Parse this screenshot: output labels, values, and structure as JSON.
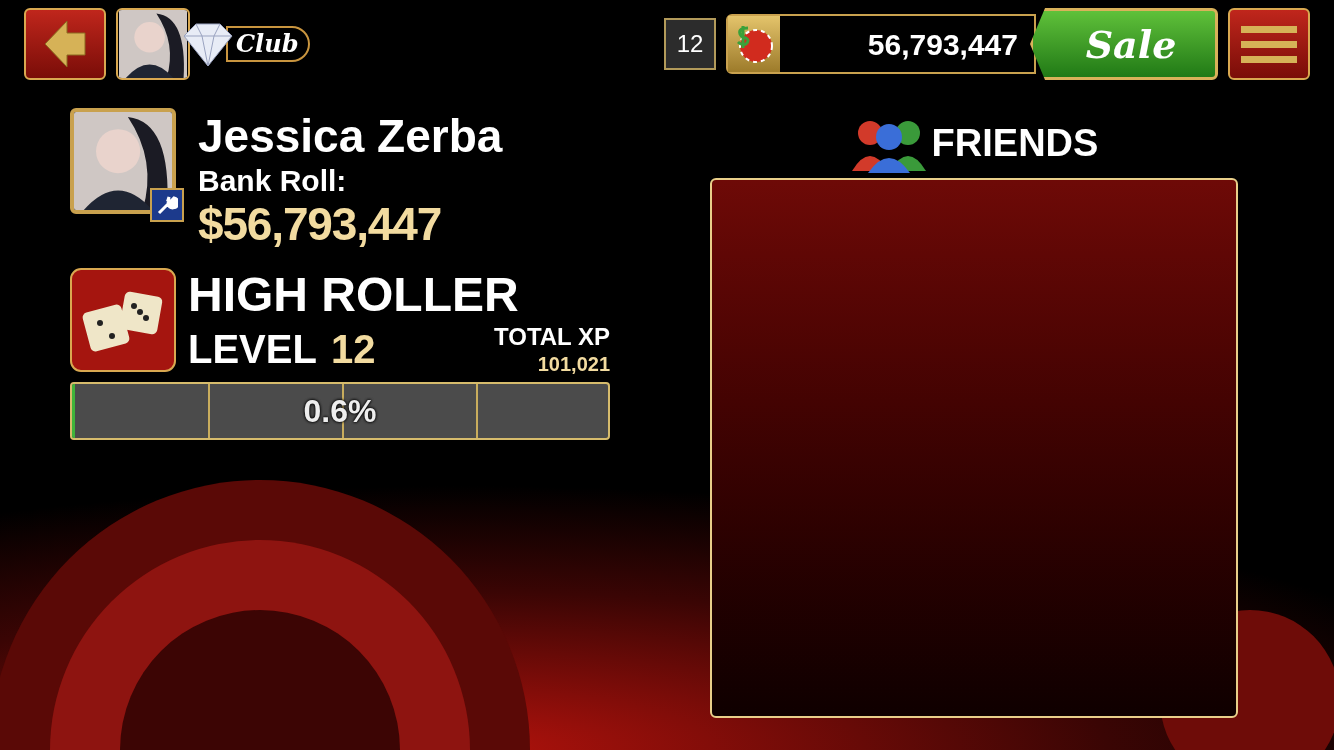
{
  "top_bar": {
    "club_badge": "Club",
    "level_badge": "12",
    "chips": "56,793,447",
    "sale_button": "Sale"
  },
  "profile": {
    "name": "Jessica Zerba",
    "bank_roll_label": "Bank Roll:",
    "bank_roll": "$56,793,447"
  },
  "rank": {
    "title": "HIGH ROLLER",
    "level_label": "LEVEL",
    "level": "12",
    "total_xp_label": "TOTAL XP",
    "total_xp": "101,021"
  },
  "progress": {
    "level": 0.006,
    "reading": "0.6%"
  },
  "friends": {
    "title": "FRIENDS"
  }
}
